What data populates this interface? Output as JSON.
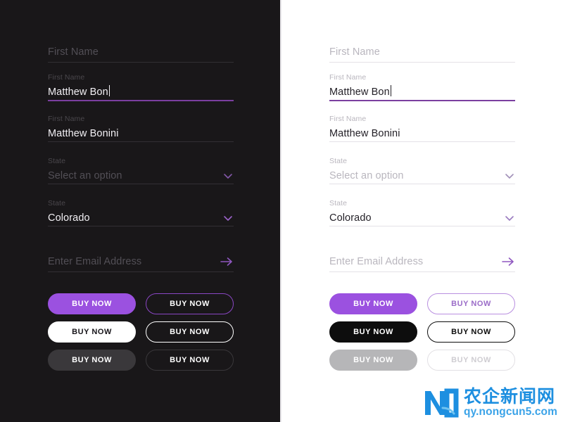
{
  "themes": {
    "dark": {
      "name": "dark-theme-panel",
      "background": "#191719",
      "fields": [
        {
          "id": "first-name-empty",
          "label": "",
          "value": "First Name",
          "state": "placeholder",
          "focused": false,
          "icon": null
        },
        {
          "id": "first-name-focused",
          "label": "First Name",
          "value": "Matthew Bon",
          "state": "filled",
          "focused": true,
          "caret": true,
          "icon": null
        },
        {
          "id": "first-name-filled",
          "label": "First Name",
          "value": "Matthew Bonini",
          "state": "filled",
          "focused": false,
          "icon": null
        },
        {
          "id": "state-empty",
          "label": "State",
          "value": "Select an option",
          "state": "placeholder",
          "focused": false,
          "icon": "chevron-down-icon"
        },
        {
          "id": "state-filled",
          "label": "State",
          "value": "Colorado",
          "state": "filled",
          "focused": false,
          "icon": "chevron-down-icon"
        },
        {
          "id": "email-subscribe",
          "label": "",
          "value": "Enter Email Address",
          "state": "placeholder",
          "focused": false,
          "icon": "arrow-right-icon"
        }
      ],
      "buttons": [
        {
          "label": "BUY NOW",
          "variant": "primary-fill"
        },
        {
          "label": "BUY NOW",
          "variant": "primary-out"
        },
        {
          "label": "BUY NOW",
          "variant": "neutral-fill"
        },
        {
          "label": "BUY NOW",
          "variant": "neutral-out"
        },
        {
          "label": "BUY NOW",
          "variant": "disabled-fill"
        },
        {
          "label": "BUY NOW",
          "variant": "disabled-out"
        }
      ]
    },
    "light": {
      "name": "light-theme-panel",
      "background": "#ffffff",
      "fields": [
        {
          "id": "first-name-empty",
          "label": "",
          "value": "First Name",
          "state": "placeholder",
          "focused": false,
          "icon": null
        },
        {
          "id": "first-name-focused",
          "label": "First Name",
          "value": "Matthew Bon",
          "state": "filled",
          "focused": true,
          "caret": true,
          "icon": null
        },
        {
          "id": "first-name-filled",
          "label": "First Name",
          "value": "Matthew Bonini",
          "state": "filled",
          "focused": false,
          "icon": null
        },
        {
          "id": "state-empty",
          "label": "State",
          "value": "Select an option",
          "state": "placeholder",
          "focused": false,
          "icon": "chevron-down-icon"
        },
        {
          "id": "state-filled",
          "label": "State",
          "value": "Colorado",
          "state": "filled",
          "focused": false,
          "icon": "chevron-down-icon"
        },
        {
          "id": "email-subscribe",
          "label": "",
          "value": "Enter Email Address",
          "state": "placeholder",
          "focused": false,
          "icon": "arrow-right-icon"
        }
      ],
      "buttons": [
        {
          "label": "BUY NOW",
          "variant": "primary-fill"
        },
        {
          "label": "BUY NOW",
          "variant": "primary-out"
        },
        {
          "label": "BUY NOW",
          "variant": "neutral-fill"
        },
        {
          "label": "BUY NOW",
          "variant": "neutral-out"
        },
        {
          "label": "BUY NOW",
          "variant": "disabled-fill"
        },
        {
          "label": "BUY NOW",
          "variant": "disabled-out"
        }
      ]
    }
  },
  "colors": {
    "accent_purple": "#9b51e0",
    "accent_purple_underline": "#7b3fa0",
    "dark_background": "#191719",
    "light_background": "#ffffff",
    "dark_divider": "#322f34",
    "light_divider": "#e4e1e7",
    "disabled_gray_light": "#b6b6b8",
    "disabled_gray_dark": "#3a383b",
    "watermark_blue": "#1d8fe0"
  },
  "watermark": {
    "chinese_text": "农企新闻网",
    "url_text": "qy.nongcun5.com",
    "logo_letters": "ND"
  }
}
